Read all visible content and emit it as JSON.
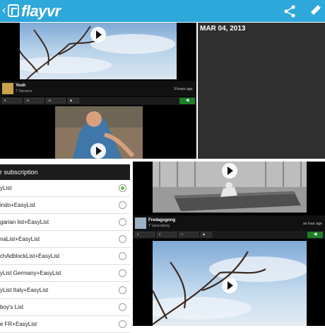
{
  "app": {
    "title": "flayvr"
  },
  "toolbar": {
    "back_icon": "chevron-left-icon",
    "share_icon": "share-icon",
    "edit_icon": "pencil-icon"
  },
  "date_section": {
    "label": "MAR 04, 2013"
  },
  "moment1": {
    "user": "Yosh",
    "location": "T Tarrance",
    "time": "3 hours ago",
    "likes": "",
    "comments": "16",
    "shares": "16"
  },
  "moment2": {
    "user": "Fredagsgong",
    "location": "T Vanersborg",
    "time": "an hour ago",
    "likes": "0",
    "comments": "0",
    "shares": ""
  },
  "subscription": {
    "header": "r subscription",
    "items": [
      {
        "label": "yList",
        "selected": true
      },
      {
        "label": "indo+EasyList",
        "selected": false
      },
      {
        "label": "garian list+EasyList",
        "selected": false
      },
      {
        "label": "naList+EasyList",
        "selected": false
      },
      {
        "label": "chAdblockList+EasyList",
        "selected": false
      },
      {
        "label": "yList Germany+EasyList",
        "selected": false
      },
      {
        "label": "yList Italy+EasyList",
        "selected": false
      },
      {
        "label": "boy's List",
        "selected": false
      },
      {
        "label": "e FR+EasyList",
        "selected": false
      }
    ]
  },
  "colors": {
    "accent": "#2ea7da",
    "share_green": "#1e7e2b",
    "selected_radio": "#67c23a"
  }
}
